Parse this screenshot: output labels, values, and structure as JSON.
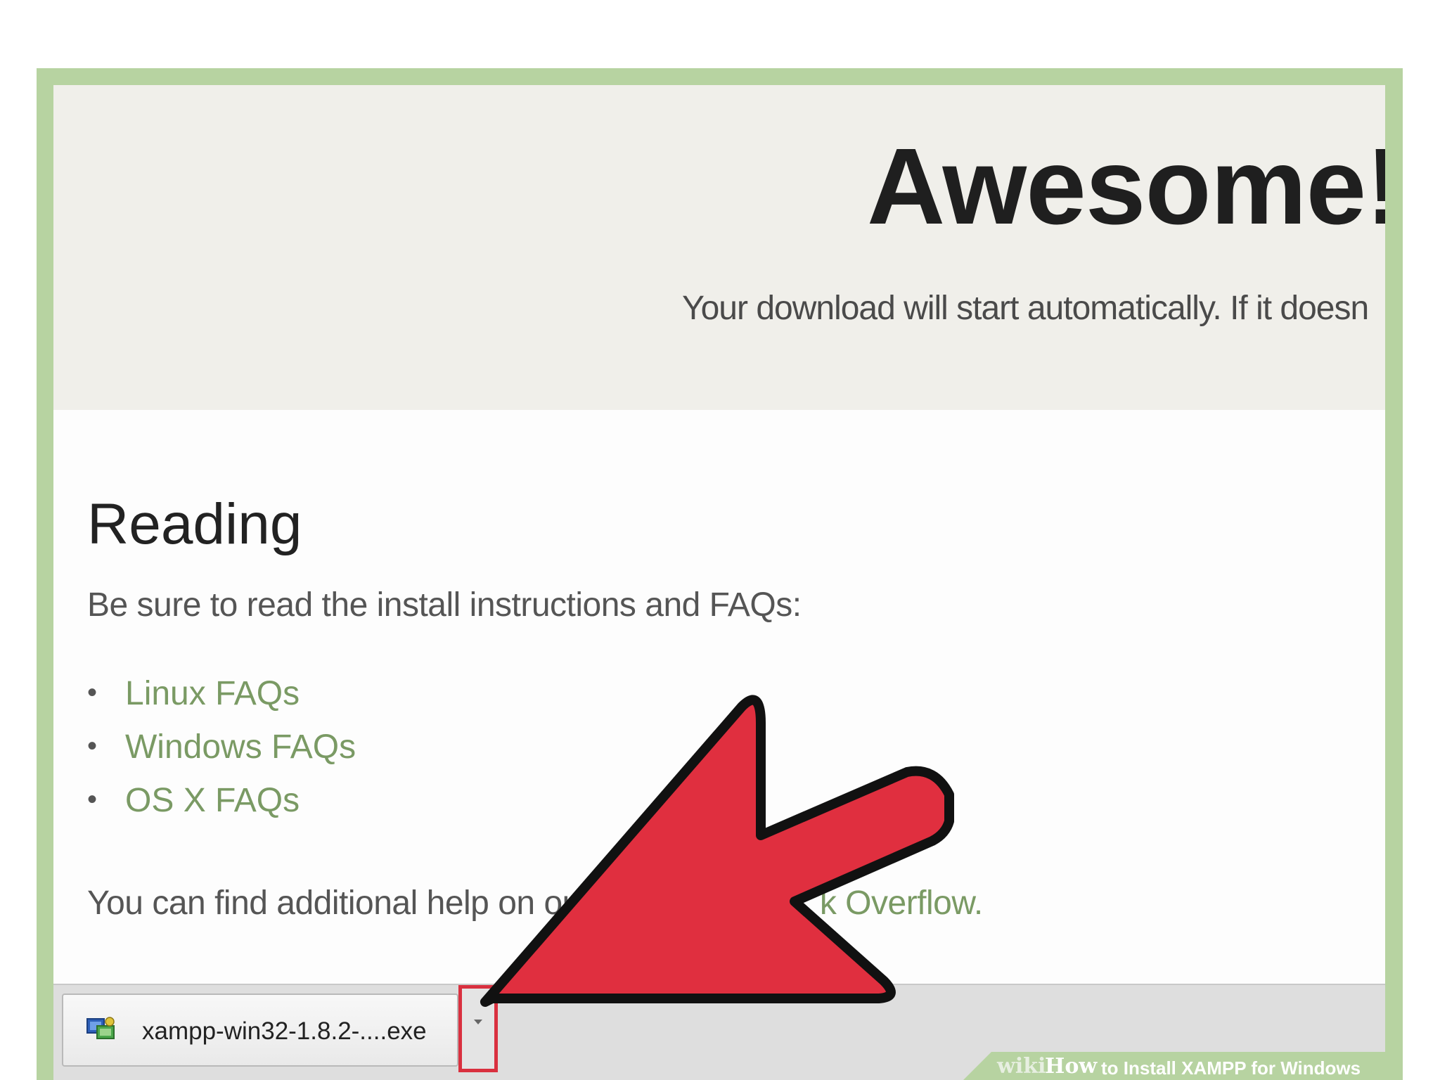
{
  "hero": {
    "title": "Awesome!",
    "subtitle": "Your download will start automatically. If it doesn"
  },
  "reading": {
    "title": "Reading",
    "intro": "Be sure to read the install instructions and FAQs:",
    "faqs": [
      {
        "label": "Linux FAQs"
      },
      {
        "label": "Windows FAQs"
      },
      {
        "label": "OS X FAQs"
      }
    ],
    "help_prefix": "You can find additional help on ou",
    "help_link": "k Overflow."
  },
  "download": {
    "file_name": "xampp-win32-1.8.2-....exe",
    "file_icon": "installer-icon",
    "dropdown_icon": "chevron-down-icon"
  },
  "watermark": {
    "wiki": "wiki",
    "how": "How",
    "rest": "to Install XAMPP for Windows"
  },
  "colors": {
    "frame": "#b7d3a1",
    "link": "#7a9a64",
    "highlight": "#d9303f",
    "arrow": "#e02f3f"
  }
}
